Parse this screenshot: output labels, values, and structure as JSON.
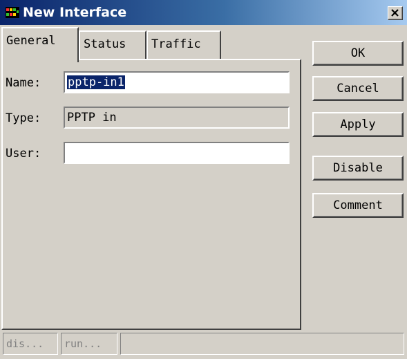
{
  "window": {
    "title": "New Interface",
    "close_glyph": "✕"
  },
  "tabs": [
    {
      "label": "General",
      "active": true
    },
    {
      "label": "Status",
      "active": false
    },
    {
      "label": "Traffic",
      "active": false
    }
  ],
  "form": {
    "name_label": "Name:",
    "name_value": "pptp-in1",
    "type_label": "Type:",
    "type_value": "PPTP in",
    "user_label": "User:",
    "user_value": ""
  },
  "buttons": {
    "ok": "OK",
    "cancel": "Cancel",
    "apply": "Apply",
    "disable": "Disable",
    "comment": "Comment"
  },
  "statusbar": {
    "cell1": "dis...",
    "cell2": "run...",
    "cell3": ""
  },
  "colors": {
    "title_start": "#0a246a",
    "title_end": "#a6caf0",
    "face": "#d4d0c8",
    "selection": "#0a246a"
  }
}
